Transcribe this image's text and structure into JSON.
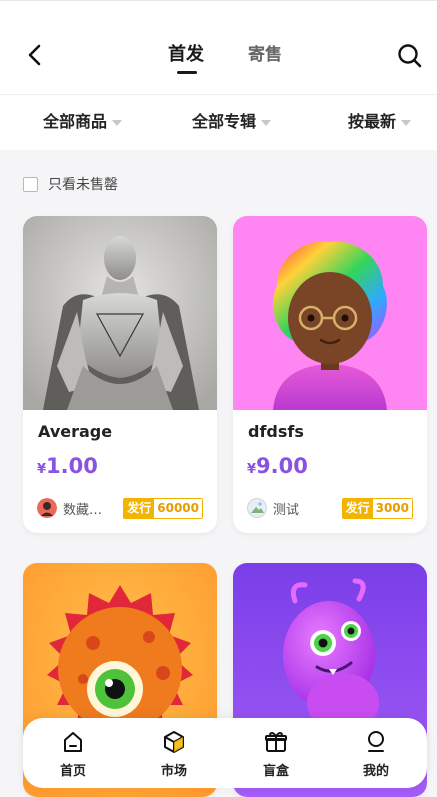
{
  "header": {
    "tabs": [
      {
        "label": "首发",
        "active": true
      },
      {
        "label": "寄售",
        "active": false
      }
    ]
  },
  "filters": {
    "items": [
      {
        "label": "全部商品"
      },
      {
        "label": "全部专辑"
      },
      {
        "label": "按最新"
      }
    ]
  },
  "only_unsold": {
    "label": "只看未售罄",
    "checked": false
  },
  "cards": [
    {
      "title": "Average",
      "currency": "¥",
      "price": "1.00",
      "creator": "数藏…",
      "badge_label": "发行",
      "badge_count": "60000"
    },
    {
      "title": "dfdsfs",
      "currency": "¥",
      "price": "9.00",
      "creator": "测试",
      "badge_label": "发行",
      "badge_count": "3000"
    },
    {
      "title": "",
      "price": ""
    },
    {
      "title": "",
      "price": ""
    }
  ],
  "bottom_nav": {
    "items": [
      {
        "label": "首页",
        "icon": "home-icon"
      },
      {
        "label": "市场",
        "icon": "cube-icon"
      },
      {
        "label": "盲盒",
        "icon": "gift-icon"
      },
      {
        "label": "我的",
        "icon": "user-icon"
      }
    ]
  },
  "colors": {
    "accent": "#8a52e0",
    "badge": "#f3b400",
    "card2_bg": "#ff86f2",
    "card3_bg": "#ffae3d",
    "card4_bg": "#8744ec"
  }
}
